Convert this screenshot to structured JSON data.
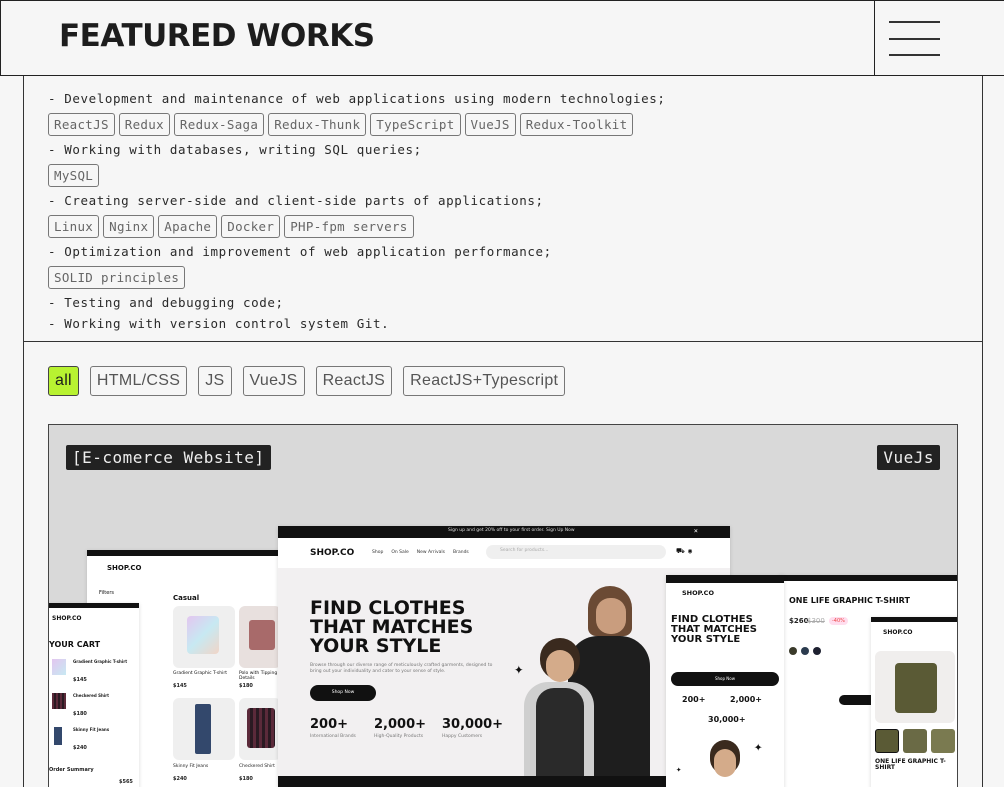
{
  "header": {
    "title": "FEATURED WORKS",
    "menu_icon": "hamburger-icon"
  },
  "duties": [
    {
      "text": "- Development and maintenance of web applications using modern technologies;",
      "tags": [
        "ReactJS",
        "Redux",
        "Redux-Saga",
        "Redux-Thunk",
        "TypeScript",
        "VueJS",
        "Redux-Toolkit"
      ]
    },
    {
      "text": "- Working with databases, writing SQL queries;",
      "tags": [
        "MySQL"
      ]
    },
    {
      "text": "- Creating server-side and client-side parts of applications;",
      "tags": [
        "Linux",
        "Nginx",
        "Apache",
        "Docker",
        "PHP-fpm servers"
      ]
    },
    {
      "text": "- Optimization and improvement of web application performance;",
      "tags": [
        "SOLID principles"
      ]
    },
    {
      "text": "- Testing and debugging code;",
      "tags": []
    },
    {
      "text": "- Working with version control system Git.",
      "tags": []
    }
  ],
  "filters": [
    {
      "label": "all",
      "active": true
    },
    {
      "label": "HTML/CSS",
      "active": false
    },
    {
      "label": "JS",
      "active": false
    },
    {
      "label": "VueJS",
      "active": false
    },
    {
      "label": "ReactJS",
      "active": false
    },
    {
      "label": "ReactJS+Typescript",
      "active": false
    }
  ],
  "project": {
    "title": "[E-comerce Website]",
    "tech": "VueJs",
    "preview": {
      "brand": "SHOP.CO",
      "promo": "Sign up and get 20% off to your first order. Sign Up Now",
      "nav": [
        "Shop",
        "On Sale",
        "New Arrivals",
        "Brands"
      ],
      "search_placeholder": "Search for products...",
      "hero_title": "FIND CLOTHES THAT MATCHES YOUR STYLE",
      "hero_desc": "Browse through our diverse range of meticulously crafted garments, designed to bring out your individuality and cater to your sense of style.",
      "cta": "Shop Now",
      "stats": [
        {
          "value": "200+",
          "label": "International Brands"
        },
        {
          "value": "2,000+",
          "label": "High-Quality Products"
        },
        {
          "value": "30,000+",
          "label": "Happy Customers"
        }
      ],
      "cart_title": "YOUR CART",
      "cart_items": [
        {
          "name": "Gradient Graphic T-shirt",
          "price": "$145"
        },
        {
          "name": "Checkered Shirt",
          "price": "$180"
        },
        {
          "name": "Skinny Fit Jeans",
          "price": "$240"
        }
      ],
      "order_summary": "Order Summary",
      "order_total": "$565",
      "category": "Casual",
      "filters_label": "Filters",
      "products": [
        {
          "name": "Gradient Graphic T-shirt",
          "price": "$145"
        },
        {
          "name": "Polo with Tipping Details",
          "price": "$180"
        },
        {
          "name": "Skinny Fit Jeans",
          "price": "$240"
        },
        {
          "name": "Checkered Shirt",
          "price": "$180"
        }
      ],
      "product_title": "ONE LIFE GRAPHIC T-SHIRT",
      "product_price": "$260",
      "product_old_price": "$300",
      "product_discount": "-40%",
      "add_to_cart": "Add to Cart"
    }
  },
  "colors": {
    "accent": "#b8f231",
    "frame": "#333333",
    "background": "#f6f6f6"
  }
}
